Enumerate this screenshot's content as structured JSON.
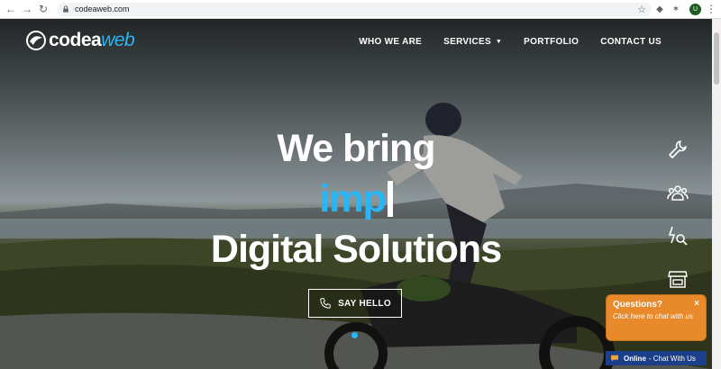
{
  "browser": {
    "url": "codeaweb.com",
    "profile_initial": "U"
  },
  "logo": {
    "part1": "codea",
    "part2": "web"
  },
  "nav": {
    "items": [
      "WHO WE ARE",
      "SERVICES",
      "PORTFOLIO",
      "CONTACT US"
    ]
  },
  "hero": {
    "line1": "We bring",
    "line2": "imp",
    "line3": "Digital Solutions",
    "cta_label": "SAY HELLO"
  },
  "side_icons": [
    "wrench-icon",
    "team-icon",
    "flash-search-icon",
    "shop-icon"
  ],
  "chat": {
    "title": "Questions?",
    "subtitle": "Click here to chat with us",
    "close": "×",
    "status": "Online",
    "status_rest": "- Chat With Us"
  },
  "colors": {
    "accent": "#29b6f6",
    "chat_orange": "#e8892c",
    "chat_blue": "#1c3f8a"
  }
}
